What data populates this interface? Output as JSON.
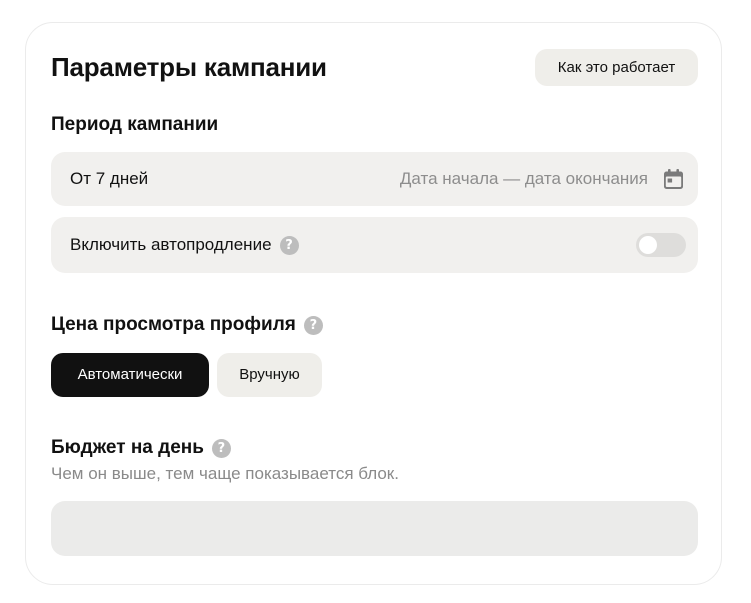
{
  "header": {
    "title": "Параметры кампании",
    "how_it_works_label": "Как это работает"
  },
  "period": {
    "label": "Период кампании",
    "min_duration": "От 7 дней",
    "date_range_placeholder": "Дата начала — дата окончания",
    "icon": "calendar-icon"
  },
  "auto_renew": {
    "label": "Включить автопродление",
    "help_icon": "?",
    "enabled": false
  },
  "price": {
    "label": "Цена просмотра профиля",
    "help_icon": "?",
    "options": [
      "Автоматически",
      "Вручную"
    ],
    "selected": "Автоматически"
  },
  "budget": {
    "label": "Бюджет на день",
    "help_icon": "?",
    "hint": "Чем он выше, тем чаще показывается блок.",
    "value": ""
  },
  "colors": {
    "accent": "#111111",
    "field_bg": "#f1f0ee",
    "muted_text": "#8d8d8d"
  }
}
